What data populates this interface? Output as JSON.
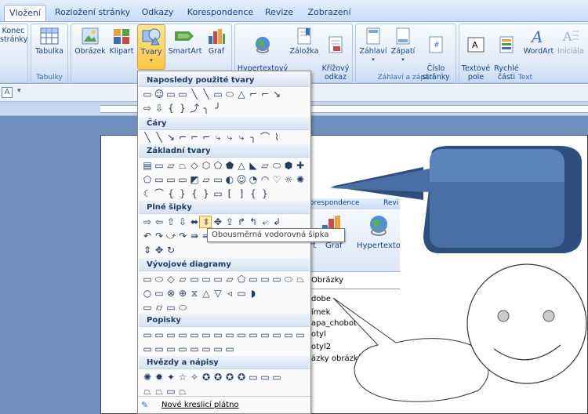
{
  "tabs": [
    "Vložení",
    "Rozložení stránky",
    "Odkazy",
    "Korespondence",
    "Revize",
    "Zobrazení"
  ],
  "ribbon": {
    "buttons": {
      "page_break": "Konec\nstránky",
      "table": "Tabulka",
      "picture": "Obrázek",
      "clipart": "Klipart",
      "shapes": "Tvary",
      "smartart": "SmartArt",
      "chart": "Graf",
      "hyperlink": "Hypertextový\nodkaz",
      "bookmark": "Záložka",
      "crossref": "Křížový\nodkaz",
      "header": "Záhlaví",
      "footer": "Zápatí",
      "page_number": "Číslo\nstránky",
      "textbox": "Textové\npole",
      "quickparts": "Rychlé\nčásti",
      "wordart": "WordArt",
      "dropcap": "Iniciála"
    },
    "groups": {
      "tables": "Tabulky",
      "header_footer": "Záhlaví a zápatí",
      "text": "Text"
    }
  },
  "menu": {
    "sections": [
      "Naposledy použité tvary",
      "Čáry",
      "Základní tvary",
      "Plné šipky",
      "Vývojové diagramy",
      "Popisky",
      "Hvězdy a nápisy"
    ],
    "footer": "Nové kreslicí plátno",
    "tooltip": "Obousměrná vodorovná šipka"
  },
  "inset": {
    "tab_fragment": "orespondence",
    "tab_fragment2": "Revi",
    "btn_fragment": "rt",
    "graf": "Graf",
    "hyper": "Hypertextov",
    "header": "Obrázky",
    "items": [
      "dobe",
      "ímek",
      "apa_chobot",
      "otyl",
      "otyl2",
      "ázky obrázků"
    ]
  },
  "colors": {
    "accent": "#15428b",
    "callout": "#3b5f93",
    "ribbon": "#dfe9f7",
    "doc_bg": "#6f8fbf"
  }
}
